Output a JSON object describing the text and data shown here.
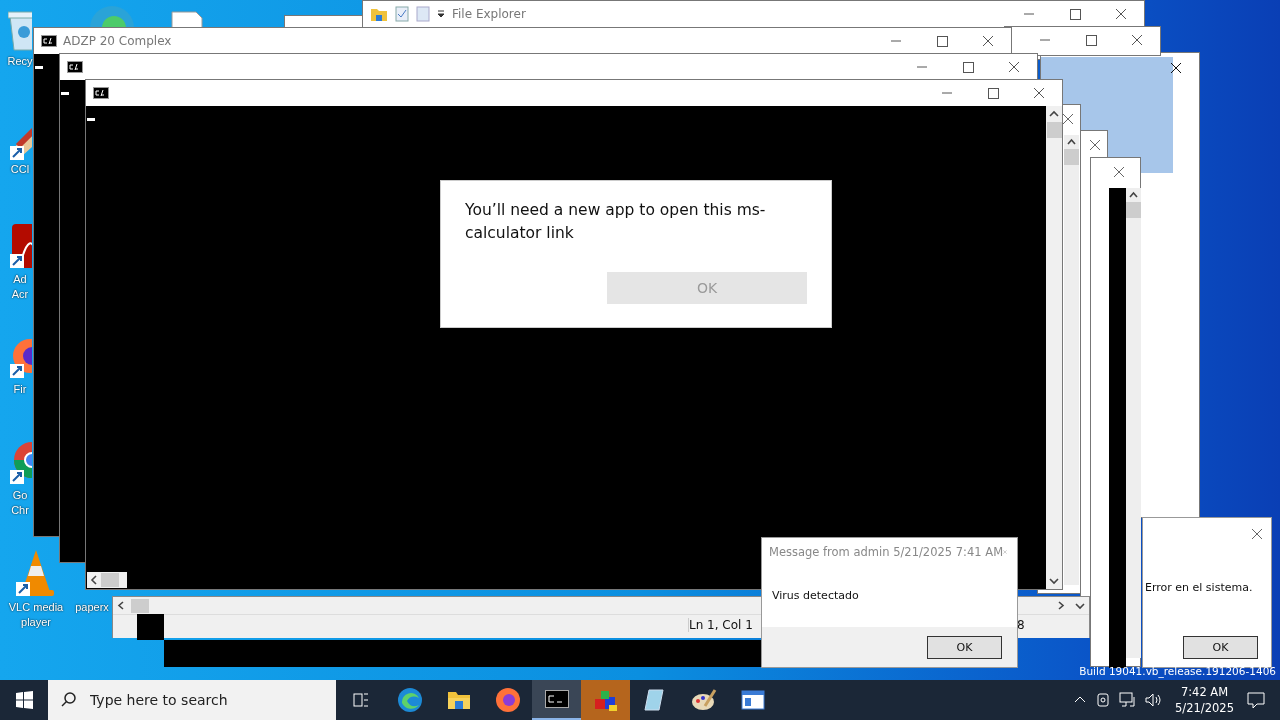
{
  "desktop_icons": [
    {
      "kind": "recycle",
      "lines": [
        "Recy"
      ]
    },
    {
      "kind": "ccleaner",
      "lines": [
        "CCl"
      ]
    },
    {
      "kind": "acrobat",
      "lines": [
        "Ad",
        "Acr"
      ]
    },
    {
      "kind": "firefox",
      "lines": [
        "Fir"
      ]
    },
    {
      "kind": "chrome",
      "lines": [
        "Go",
        "Chr"
      ]
    },
    {
      "kind": "vlc",
      "lines": [
        "VLC media",
        "player"
      ]
    },
    {
      "kind": "document",
      "lines": [
        "paperx"
      ]
    }
  ],
  "file_explorer": {
    "title": "File Explorer"
  },
  "console_title": "ADZP 20 Complex",
  "editor_status": {
    "position": "Ln 1, Col 1",
    "column_2": "8"
  },
  "app_dialog": {
    "message": "You’ll need a new app to open this ms-calculator link",
    "button": "OK"
  },
  "message_box": {
    "title": "Message from admin 5/21/2025 7:41 AM",
    "message": "Virus detectado",
    "button": "OK"
  },
  "error_box": {
    "message": "Error en el sistema.",
    "button": "OK"
  },
  "build_info": "Build 19041.vb_release.191206-1406",
  "taskbar": {
    "search_placeholder": "Type here to search",
    "apps": [
      {
        "kind": "taskview",
        "selected": false,
        "flashing": false
      },
      {
        "kind": "edge",
        "selected": false,
        "flashing": false
      },
      {
        "kind": "explorer",
        "selected": false,
        "flashing": false
      },
      {
        "kind": "firefox",
        "selected": false,
        "flashing": false
      },
      {
        "kind": "console",
        "selected": true,
        "flashing": false
      },
      {
        "kind": "boxes",
        "selected": false,
        "flashing": true
      },
      {
        "kind": "notebook",
        "selected": false,
        "flashing": false
      },
      {
        "kind": "paint",
        "selected": false,
        "flashing": false
      },
      {
        "kind": "window",
        "selected": false,
        "flashing": false
      }
    ],
    "time": "7:42 AM",
    "date": "5/21/2025"
  }
}
